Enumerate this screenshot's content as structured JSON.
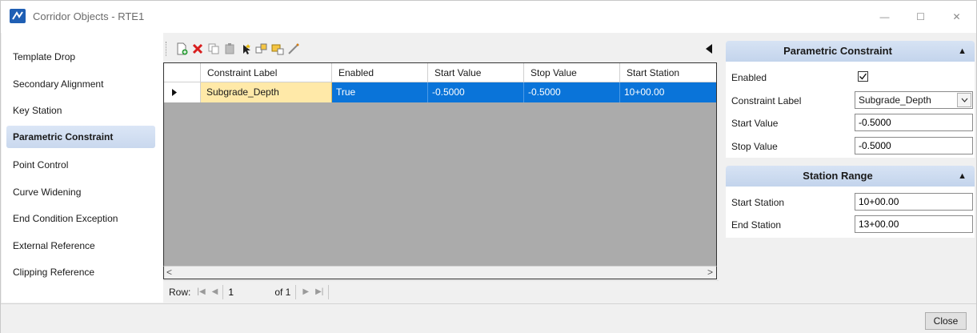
{
  "window": {
    "title": "Corridor Objects - RTE1",
    "controls": {
      "minimize": "—",
      "maximize": "☐",
      "close": "✕"
    }
  },
  "nav": {
    "items": [
      {
        "label": "Template Drop",
        "selected": false
      },
      {
        "label": "Secondary Alignment",
        "selected": false
      },
      {
        "label": "Key Station",
        "selected": false
      },
      {
        "label": "Parametric Constraint",
        "selected": true
      },
      {
        "label": "Point Control",
        "selected": false
      },
      {
        "label": "Curve Widening",
        "selected": false
      },
      {
        "label": "End Condition Exception",
        "selected": false
      },
      {
        "label": "External Reference",
        "selected": false
      },
      {
        "label": "Clipping Reference",
        "selected": false
      }
    ]
  },
  "toolbar": {
    "icons": [
      "new-row-icon",
      "delete-icon",
      "copy-icon",
      "paste-icon",
      "select-icon",
      "pick-icon",
      "properties-icon",
      "measure-icon"
    ],
    "collapse_icon": "collapse-left-icon"
  },
  "grid": {
    "columns": [
      "Constraint Label",
      "Enabled",
      "Start Value",
      "Stop Value",
      "Start Station"
    ],
    "rows": [
      {
        "cells": [
          "Subgrade_Depth",
          "True",
          "-0.5000",
          "-0.5000",
          "10+00.00"
        ]
      }
    ]
  },
  "navigator": {
    "row_label": "Row:",
    "current": "1",
    "of_text": "of 1"
  },
  "panel": {
    "parametric": {
      "title": "Parametric Constraint",
      "enabled_label": "Enabled",
      "enabled": true,
      "constraint_label_label": "Constraint Label",
      "constraint_label_value": "Subgrade_Depth",
      "start_value_label": "Start Value",
      "start_value": "-0.5000",
      "stop_value_label": "Stop Value",
      "stop_value": "-0.5000"
    },
    "station_range": {
      "title": "Station Range",
      "start_station_label": "Start Station",
      "start_station": "10+00.00",
      "end_station_label": "End Station",
      "end_station": "13+00.00"
    }
  },
  "footer": {
    "close_label": "Close"
  },
  "colors": {
    "selection": "#0a74d9",
    "edit_cell": "#ffe9a8",
    "grid_background": "#ababab",
    "section_header": "#c9d8ee"
  }
}
